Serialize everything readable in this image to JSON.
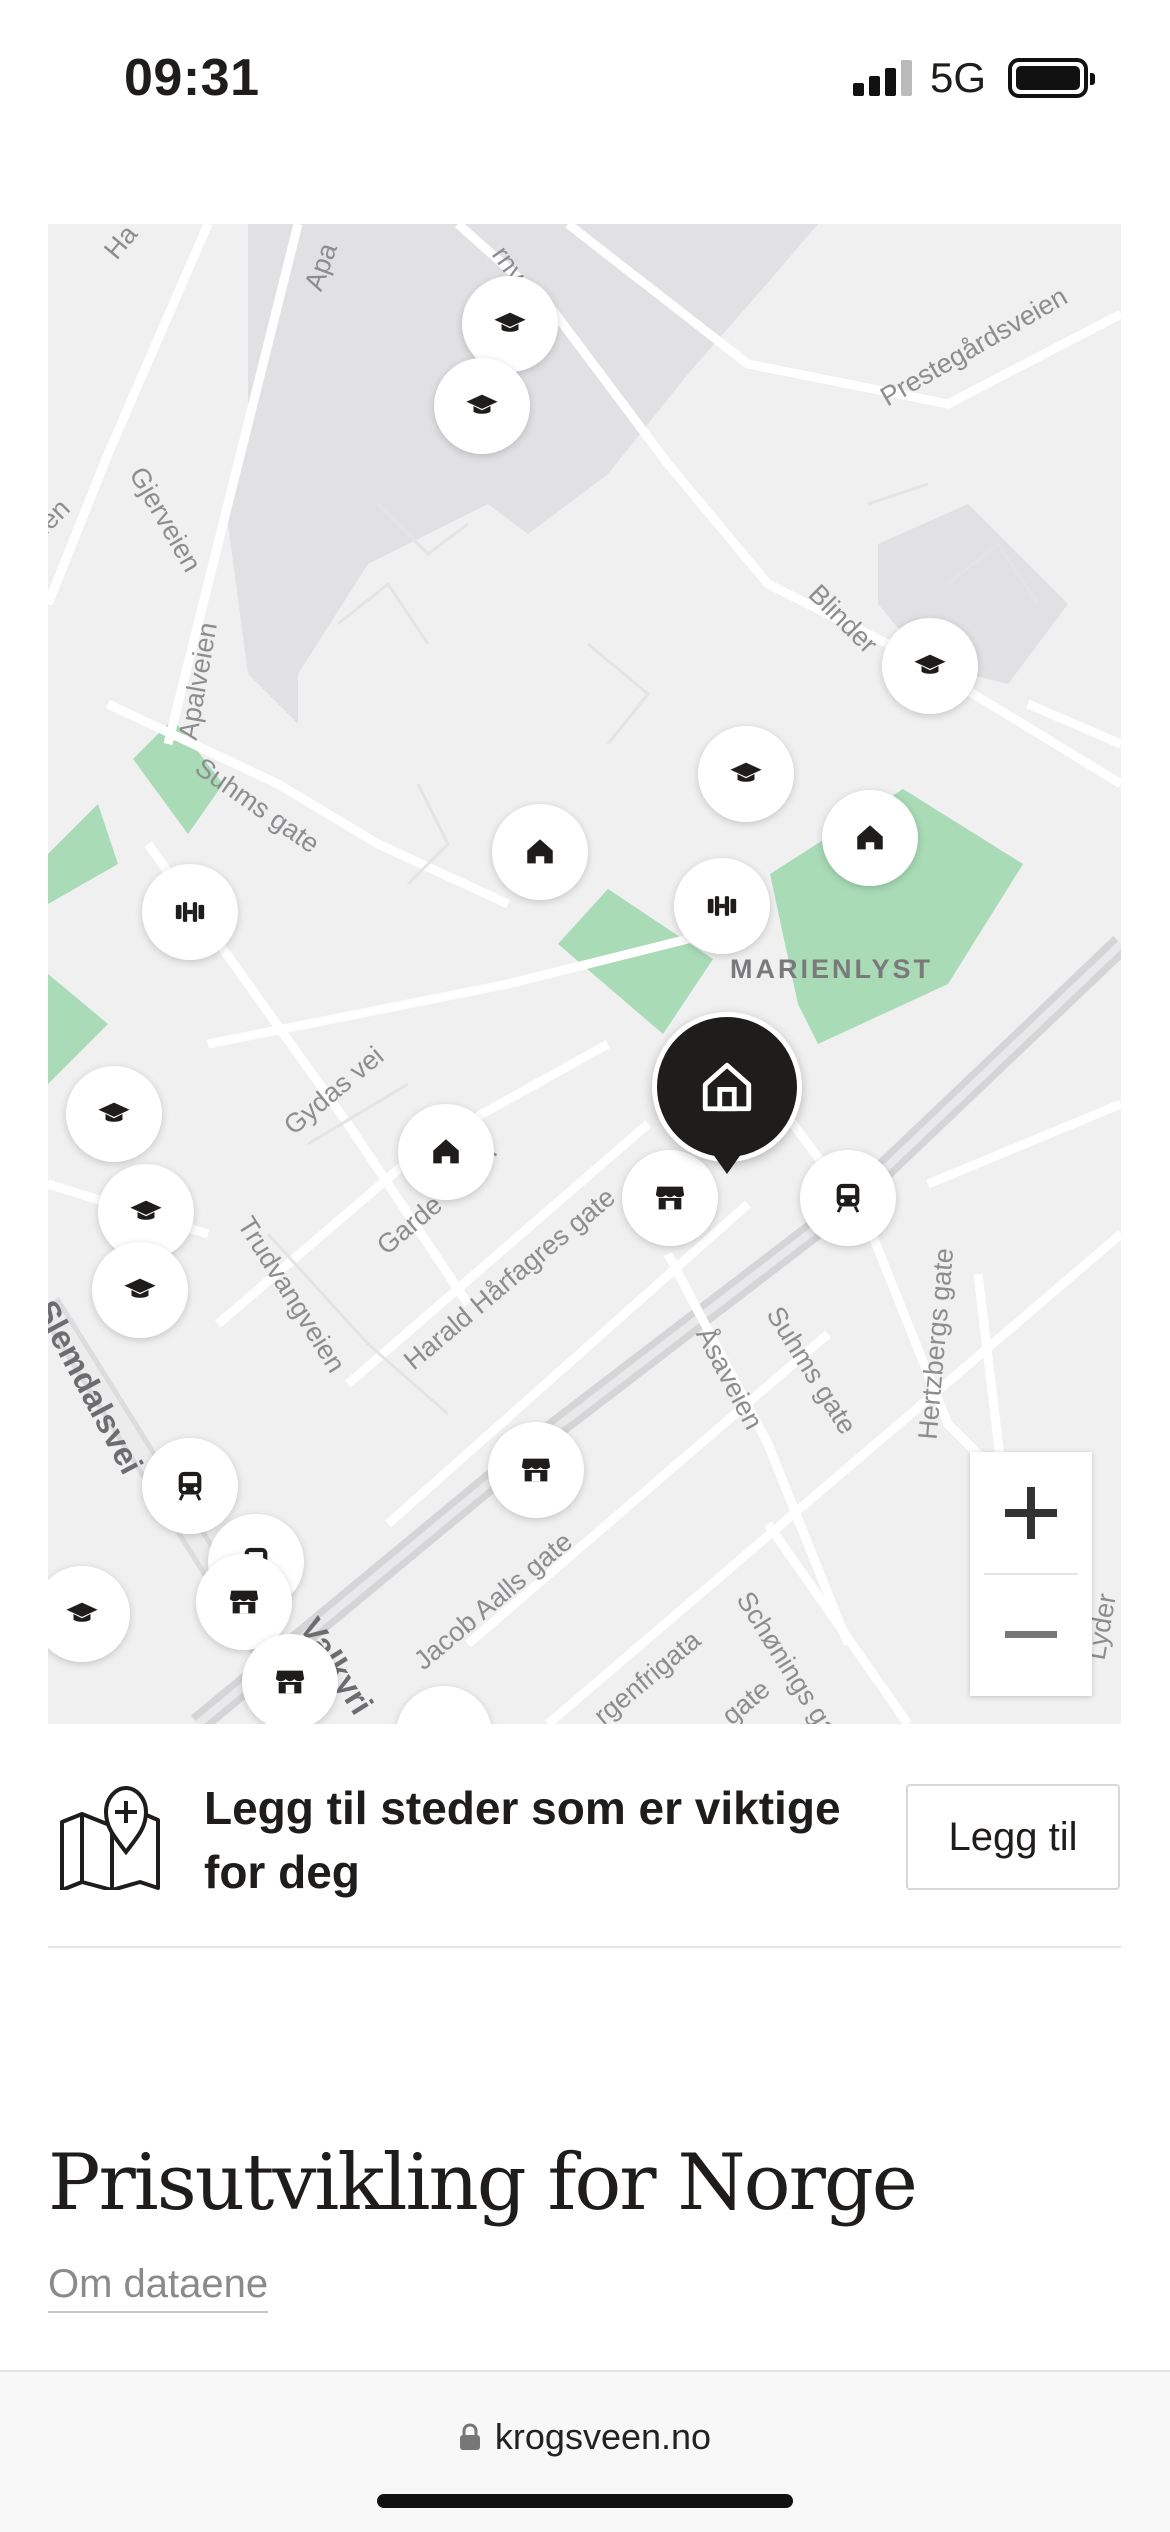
{
  "status_bar": {
    "time": "09:31",
    "network": "5G"
  },
  "map": {
    "district": "MARIENLYST",
    "streets": [
      "Ha",
      "Apa",
      "rnveien",
      "Prestegårdsveien",
      "ien",
      "Gjerveien",
      "Blinder",
      "Apalveien",
      "Suhms gate",
      "Gydas vei",
      "Garde",
      "n",
      "Trudvangveien",
      "Harald Hårfagres gate",
      "Åsaveien",
      "Suhms gate",
      "Hertzbergs gate",
      "Slemdalsvei",
      "Valkyri",
      "Jacob Aalls gate",
      "rgenfrigata",
      "Schønings gat",
      "gate",
      "Lyder",
      "o"
    ],
    "poi_icons": [
      "graduation-cap-icon",
      "kindergarten-icon",
      "dumbbell-icon",
      "shop-icon",
      "train-icon"
    ],
    "home_icon": "home-icon",
    "zoom_in_label": "+",
    "zoom_out_label": "−"
  },
  "add_places": {
    "text": "Legg til steder som er viktige for deg",
    "button_label": "Legg til",
    "icon": "map-pin-add-icon"
  },
  "section": {
    "title": "Prisutvikling for Norge",
    "link_label": "Om dataene"
  },
  "browser": {
    "url": "krogsveen.no",
    "lock_icon": "lock-icon"
  },
  "colors": {
    "pin_dark": "#1f1d1b",
    "park_green": "#a8dbb6",
    "map_bg": "#f0f0f1",
    "campus_grey": "#e1e1e4"
  }
}
